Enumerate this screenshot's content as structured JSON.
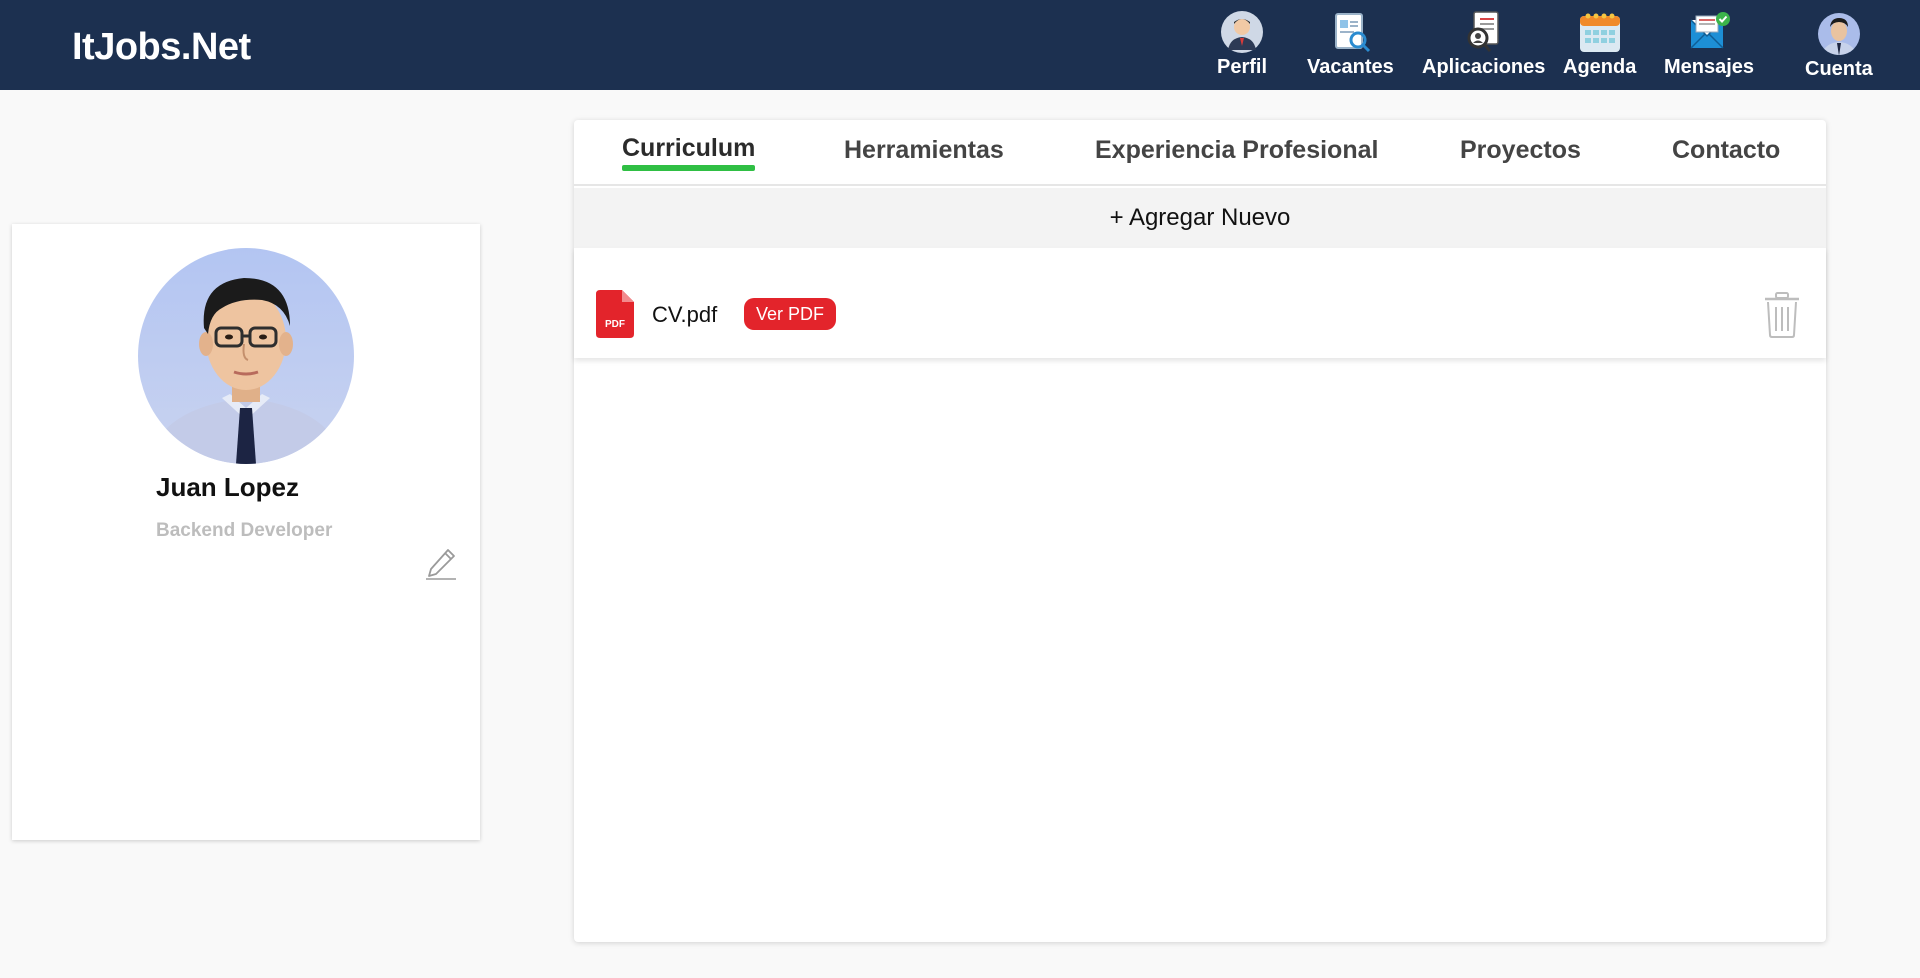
{
  "header": {
    "brand": "ItJobs.Net",
    "nav": [
      {
        "label": "Perfil",
        "icon": "user-profile-icon"
      },
      {
        "label": "Vacantes",
        "icon": "job-search-icon"
      },
      {
        "label": "Aplicaciones",
        "icon": "applications-icon"
      },
      {
        "label": "Agenda",
        "icon": "calendar-icon"
      },
      {
        "label": "Mensajes",
        "icon": "mail-icon"
      },
      {
        "label": "Cuenta",
        "icon": "account-avatar-icon"
      }
    ],
    "bg_color": "#1c3050"
  },
  "profile": {
    "name": "Juan Lopez",
    "role": "Backend Developer",
    "avatar": "profile-photo",
    "edit_icon": "pencil-icon"
  },
  "tabs": [
    {
      "label": "Curriculum",
      "active": true
    },
    {
      "label": "Herramientas",
      "active": false
    },
    {
      "label": "Experiencia Profesional",
      "active": false
    },
    {
      "label": "Proyectos",
      "active": false
    },
    {
      "label": "Contacto",
      "active": false
    }
  ],
  "main": {
    "add_new_label": "+ Agregar Nuevo",
    "files": [
      {
        "name": "CV.pdf",
        "view_label": "Ver PDF",
        "icon": "pdf-file-icon",
        "delete_icon": "trash-icon"
      }
    ]
  },
  "colors": {
    "accent_green": "#2fbf44",
    "pdf_red": "#e3242b"
  }
}
